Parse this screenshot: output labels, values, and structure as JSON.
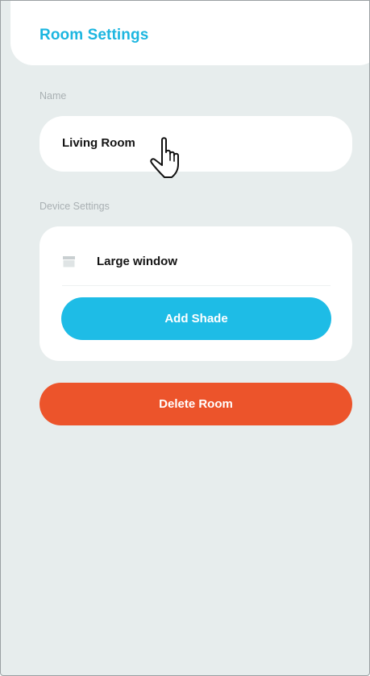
{
  "header": {
    "title": "Room Settings"
  },
  "name_section": {
    "label": "Name",
    "value": "Living Room"
  },
  "device_section": {
    "label": "Device Settings",
    "devices": [
      {
        "name": "Large window",
        "icon": "window-shade-icon"
      }
    ],
    "add_button_label": "Add Shade"
  },
  "delete_button_label": "Delete Room",
  "colors": {
    "accent": "#1ebce6",
    "title": "#1cb6e0",
    "danger": "#ec542b",
    "background": "#e7eded",
    "card": "#ffffff"
  }
}
